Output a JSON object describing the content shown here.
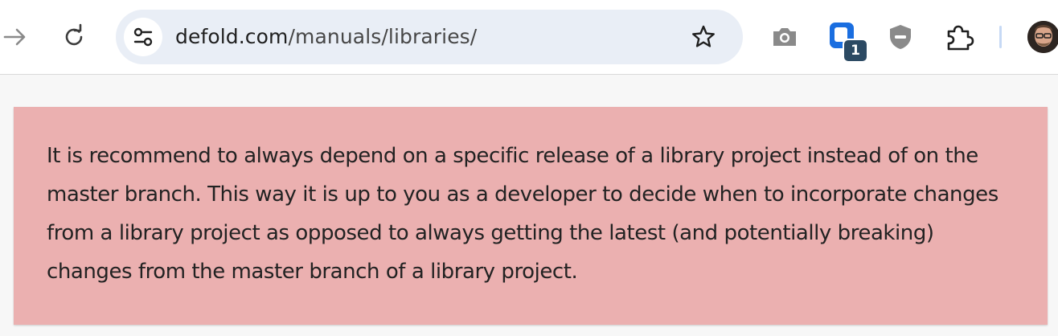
{
  "browser": {
    "url_domain": "defold.com",
    "url_path": "/manuals/libraries/",
    "extension_badge_count": "1",
    "icons": {
      "forward": "forward-arrow-icon",
      "reload": "reload-icon",
      "site_info": "tune-icon",
      "bookmark": "star-icon",
      "screenshot": "camera-icon",
      "extension": "extension-icon",
      "shield": "shield-icon",
      "extensions_menu": "puzzle-icon",
      "profile": "avatar"
    }
  },
  "alert": {
    "text": "It is recommend to always depend on a specific release of a library project instead of on the master branch. This way it is up to you as a developer to decide when to incorporate changes from a library project as opposed to always getting the latest (and potentially breaking) changes from the master branch of a library project.",
    "background": "#ebb0b0"
  }
}
